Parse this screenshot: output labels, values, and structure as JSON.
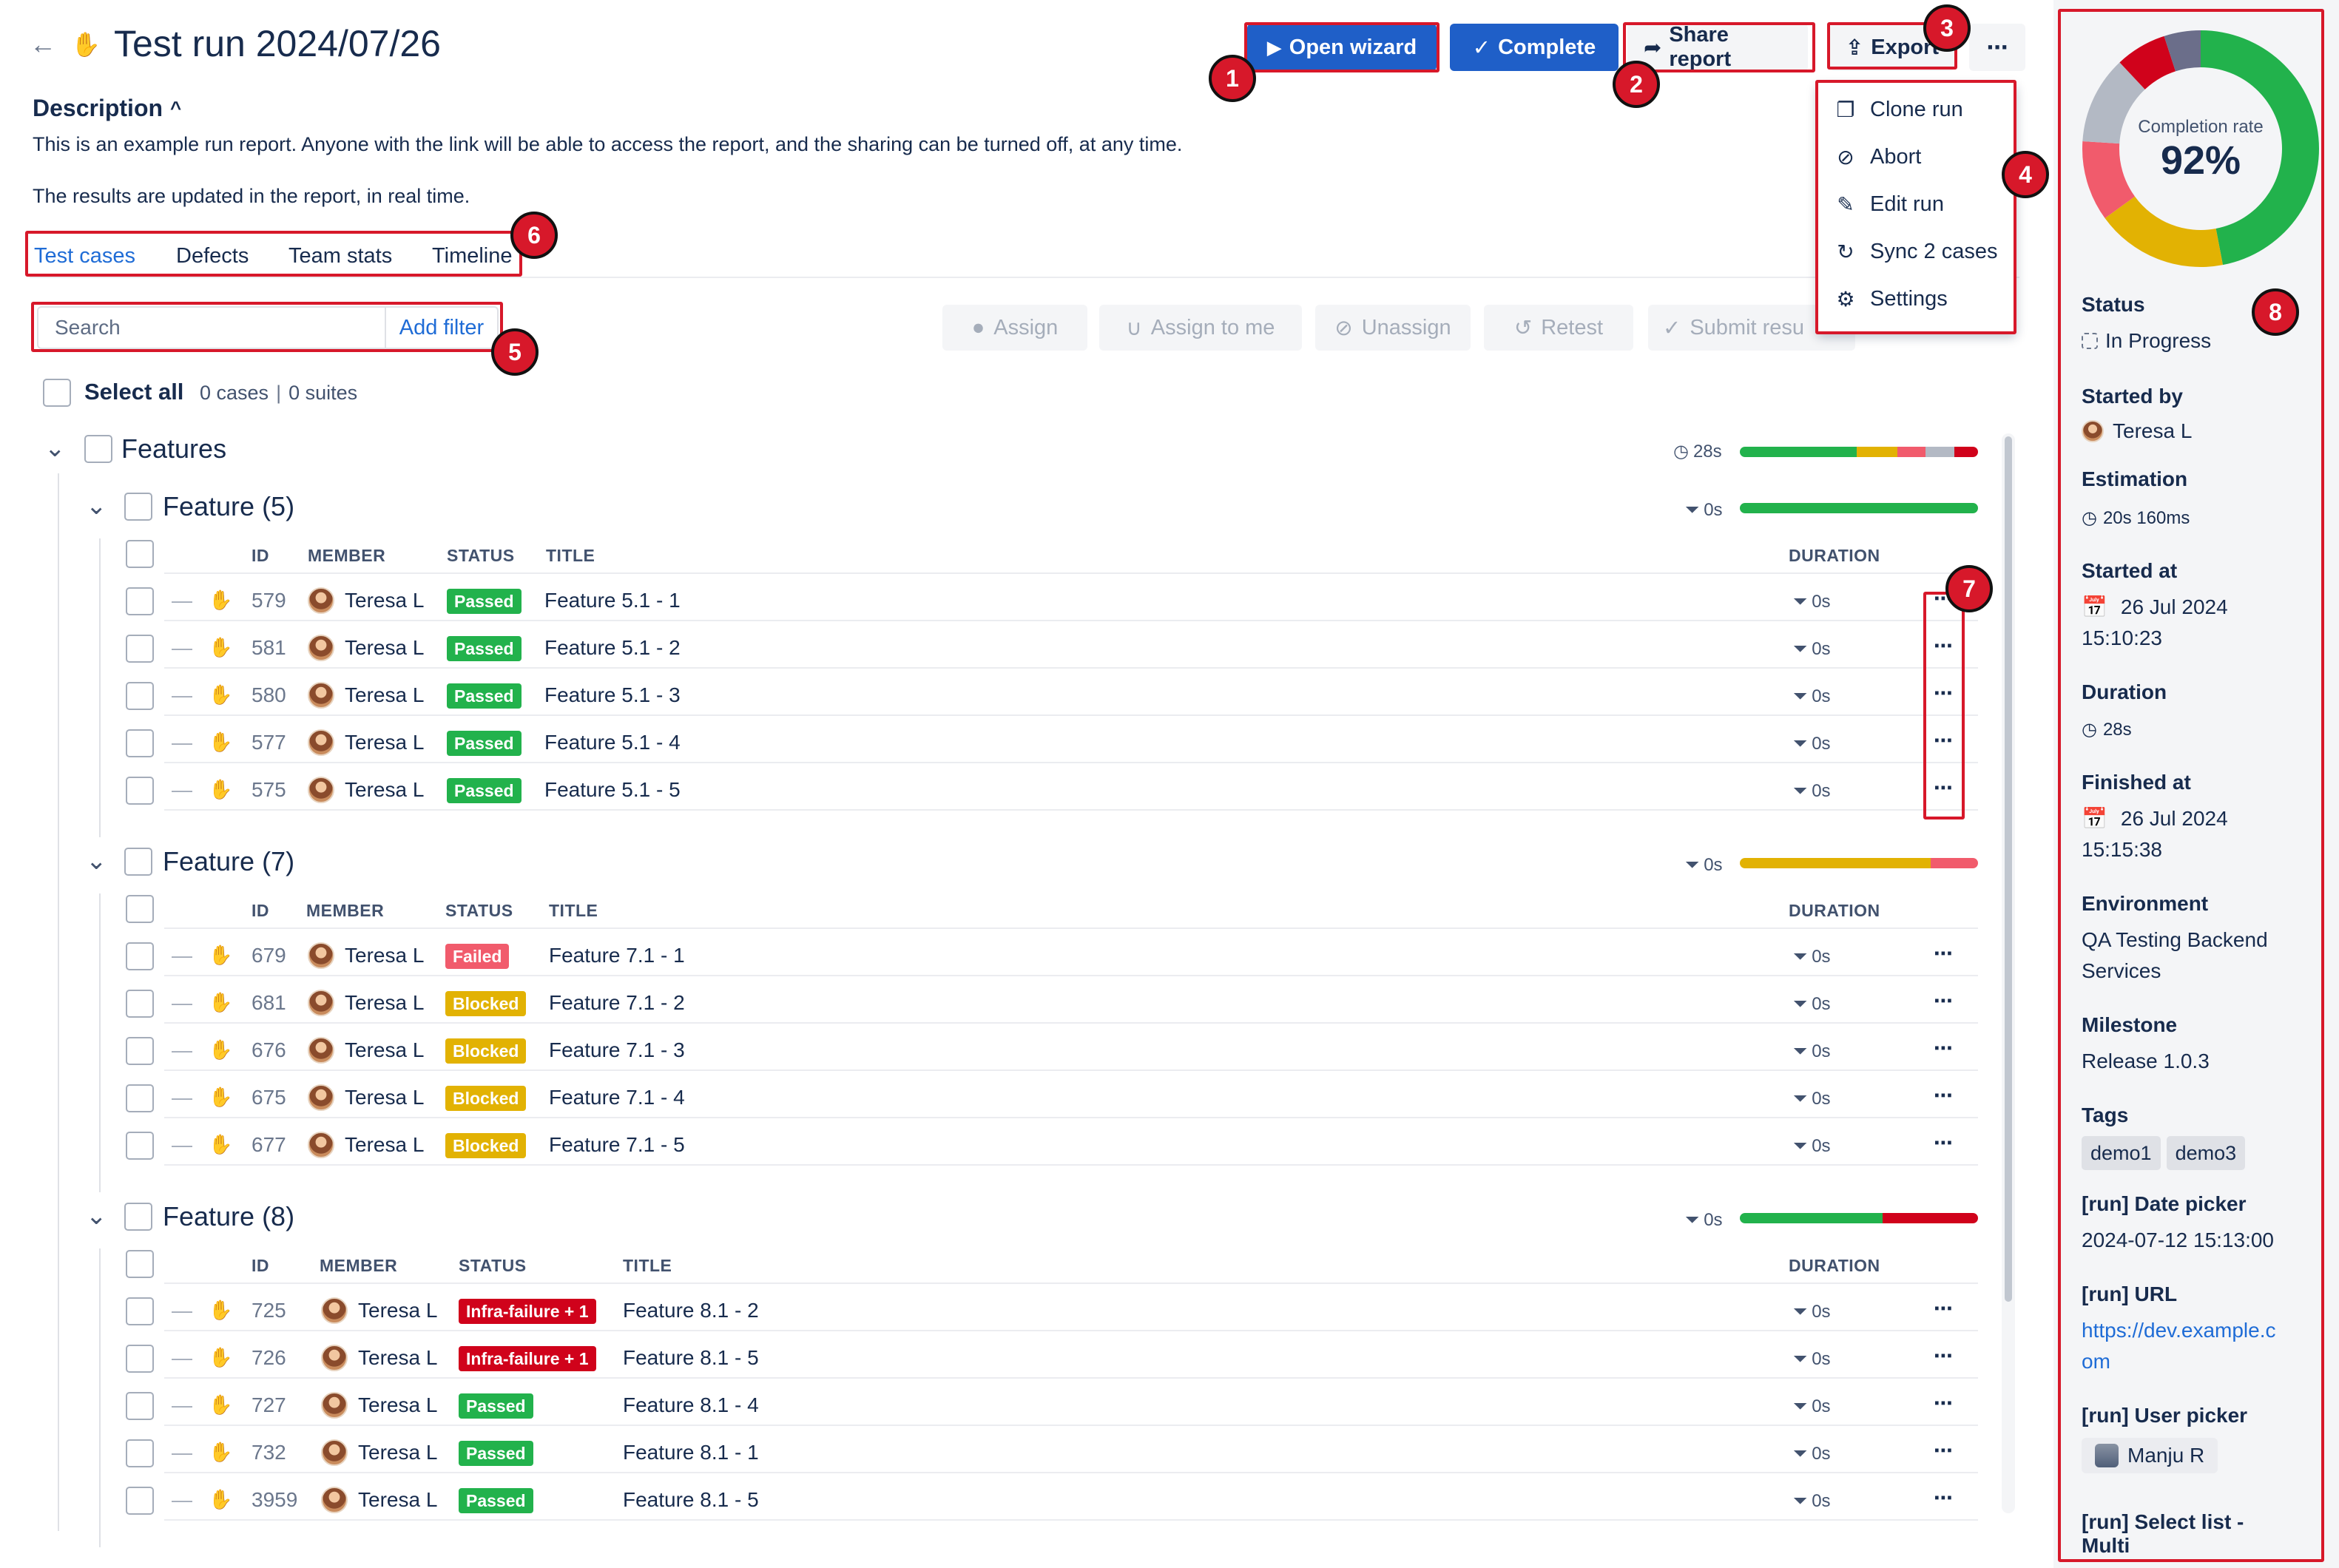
{
  "header": {
    "title": "Test run 2024/07/26",
    "buttons": {
      "open_wizard": "Open wizard",
      "complete": "Complete",
      "share_report": "Share report",
      "export": "Export",
      "more": "⋯"
    }
  },
  "description": {
    "heading": "Description",
    "line1": "This is an example run report. Anyone with the link will be able to access the report, and the sharing can be turned off, at any time.",
    "line2": "The results are updated in the report, in real time."
  },
  "tabs": [
    "Test cases",
    "Defects",
    "Team stats",
    "Timeline"
  ],
  "toolbar": {
    "search_placeholder": "Search",
    "add_filter": "Add filter",
    "actions": [
      "Assign",
      "Assign to me",
      "Unassign",
      "Retest",
      "Submit resu"
    ]
  },
  "select_all": {
    "label": "Select all",
    "cases": "0 cases",
    "suites": "0 suites"
  },
  "dropdown": {
    "items": [
      "Clone run",
      "Abort",
      "Edit run",
      "Sync 2 cases",
      "Settings"
    ]
  },
  "root_group": {
    "title": "Features",
    "duration": "28s",
    "progress": [
      {
        "color": "#22b24c",
        "fraction": 0.49
      },
      {
        "color": "#e2b203",
        "fraction": 0.17
      },
      {
        "color": "#f15b6c",
        "fraction": 0.12
      },
      {
        "color": "#b3b9c4",
        "fraction": 0.12
      },
      {
        "color": "#d0021b",
        "fraction": 0.1
      }
    ]
  },
  "columns": {
    "id": "ID",
    "member": "MEMBER",
    "status": "STATUS",
    "title": "TITLE",
    "duration": "DURATION"
  },
  "groups": [
    {
      "title": "Feature (5)",
      "duration": "0s",
      "progress": [
        {
          "color": "#22b24c",
          "fraction": 1.0
        }
      ],
      "rows": [
        {
          "id": "579",
          "member": "Teresa L",
          "status": "Passed",
          "status_color": "#22b24c",
          "title": "Feature 5.1 - 1",
          "duration": "0s"
        },
        {
          "id": "581",
          "member": "Teresa L",
          "status": "Passed",
          "status_color": "#22b24c",
          "title": "Feature 5.1 - 2",
          "duration": "0s"
        },
        {
          "id": "580",
          "member": "Teresa L",
          "status": "Passed",
          "status_color": "#22b24c",
          "title": "Feature 5.1 - 3",
          "duration": "0s"
        },
        {
          "id": "577",
          "member": "Teresa L",
          "status": "Passed",
          "status_color": "#22b24c",
          "title": "Feature 5.1 - 4",
          "duration": "0s"
        },
        {
          "id": "575",
          "member": "Teresa L",
          "status": "Passed",
          "status_color": "#22b24c",
          "title": "Feature 5.1 - 5",
          "duration": "0s"
        }
      ]
    },
    {
      "title": "Feature (7)",
      "duration": "0s",
      "progress": [
        {
          "color": "#e2b203",
          "fraction": 0.8
        },
        {
          "color": "#f15b6c",
          "fraction": 0.2
        }
      ],
      "rows": [
        {
          "id": "679",
          "member": "Teresa L",
          "status": "Failed",
          "status_color": "#f15b6c",
          "title": "Feature 7.1 - 1",
          "duration": "0s"
        },
        {
          "id": "681",
          "member": "Teresa L",
          "status": "Blocked",
          "status_color": "#e2b203",
          "title": "Feature 7.1 - 2",
          "duration": "0s"
        },
        {
          "id": "676",
          "member": "Teresa L",
          "status": "Blocked",
          "status_color": "#e2b203",
          "title": "Feature 7.1 - 3",
          "duration": "0s"
        },
        {
          "id": "675",
          "member": "Teresa L",
          "status": "Blocked",
          "status_color": "#e2b203",
          "title": "Feature 7.1 - 4",
          "duration": "0s"
        },
        {
          "id": "677",
          "member": "Teresa L",
          "status": "Blocked",
          "status_color": "#e2b203",
          "title": "Feature 7.1 - 5",
          "duration": "0s"
        }
      ]
    },
    {
      "title": "Feature (8)",
      "duration": "0s",
      "progress": [
        {
          "color": "#22b24c",
          "fraction": 0.6
        },
        {
          "color": "#d0021b",
          "fraction": 0.4
        }
      ],
      "rows": [
        {
          "id": "725",
          "member": "Teresa L",
          "status": "Infra-failure + 1",
          "status_color": "#d0021b",
          "title": "Feature 8.1 - 2",
          "duration": "0s"
        },
        {
          "id": "726",
          "member": "Teresa L",
          "status": "Infra-failure + 1",
          "status_color": "#d0021b",
          "title": "Feature 8.1 - 5",
          "duration": "0s"
        },
        {
          "id": "727",
          "member": "Teresa L",
          "status": "Passed",
          "status_color": "#22b24c",
          "title": "Feature 8.1 - 4",
          "duration": "0s"
        },
        {
          "id": "732",
          "member": "Teresa L",
          "status": "Passed",
          "status_color": "#22b24c",
          "title": "Feature 8.1 - 1",
          "duration": "0s"
        },
        {
          "id": "3959",
          "member": "Teresa L",
          "status": "Passed",
          "status_color": "#22b24c",
          "title": "Feature 8.1 - 5",
          "duration": "0s"
        }
      ]
    }
  ],
  "sidebar": {
    "completion_label": "Completion rate",
    "completion_value": "92%",
    "donut": [
      {
        "color": "#22b24c",
        "fraction": 0.47
      },
      {
        "color": "#e2b203",
        "fraction": 0.18
      },
      {
        "color": "#f15b6c",
        "fraction": 0.11
      },
      {
        "color": "#b3b9c4",
        "fraction": 0.12
      },
      {
        "color": "#d0021b",
        "fraction": 0.07
      },
      {
        "color": "#6b6e8a",
        "fraction": 0.05
      }
    ],
    "status_label": "Status",
    "status_value": "In Progress",
    "started_by_label": "Started by",
    "started_by_value": "Teresa L",
    "estimation_label": "Estimation",
    "estimation_value": "20s 160ms",
    "started_at_label": "Started at",
    "started_at_date": "26 Jul 2024",
    "started_at_time": "15:10:23",
    "duration_label": "Duration",
    "duration_value": "28s",
    "finished_at_label": "Finished at",
    "finished_at_date": "26 Jul 2024",
    "finished_at_time": "15:15:38",
    "environment_label": "Environment",
    "environment_line1": "QA Testing Backend",
    "environment_line2": "Services",
    "milestone_label": "Milestone",
    "milestone_value": "Release 1.0.3",
    "tags_label": "Tags",
    "tags": [
      "demo1",
      "demo3"
    ],
    "date_picker_label": "[run] Date picker",
    "date_picker_value": "2024-07-12 15:13:00",
    "url_label": "[run] URL",
    "url_line1": "https://dev.example.c",
    "url_line2": "om",
    "user_picker_label": "[run] User picker",
    "user_picker_value": "Manju R",
    "select_list_label_line1": "[run] Select list -",
    "select_list_label_line2": "Multi"
  },
  "annotations": [
    "1",
    "2",
    "3",
    "4",
    "5",
    "6",
    "7",
    "8"
  ]
}
